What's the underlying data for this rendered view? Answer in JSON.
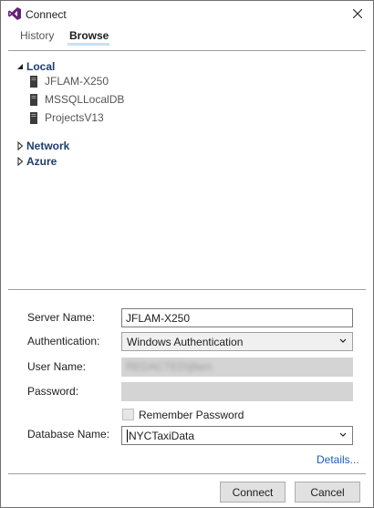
{
  "window": {
    "title": "Connect"
  },
  "tabs": {
    "history": "History",
    "browse": "Browse"
  },
  "tree": {
    "local": {
      "label": "Local",
      "servers": [
        "JFLAM-X250",
        "MSSQLLocalDB",
        "ProjectsV13"
      ]
    },
    "network": {
      "label": "Network"
    },
    "azure": {
      "label": "Azure"
    }
  },
  "form": {
    "server_name_label": "Server Name:",
    "server_name_value": "JFLAM-X250",
    "authentication_label": "Authentication:",
    "authentication_value": "Windows Authentication",
    "user_name_label": "User Name:",
    "user_name_value": "REDACTED\\jflam",
    "password_label": "Password:",
    "remember_password_label": "Remember Password",
    "database_name_label": "Database Name:",
    "database_name_value": "NYCTaxiData",
    "details_link": "Details..."
  },
  "buttons": {
    "connect": "Connect",
    "cancel": "Cancel"
  },
  "colors": {
    "accent": "#1a5fb4",
    "tree_header": "#1e3c72",
    "tab_underline": "#c7e0f4",
    "app_icon": "#68217a"
  }
}
